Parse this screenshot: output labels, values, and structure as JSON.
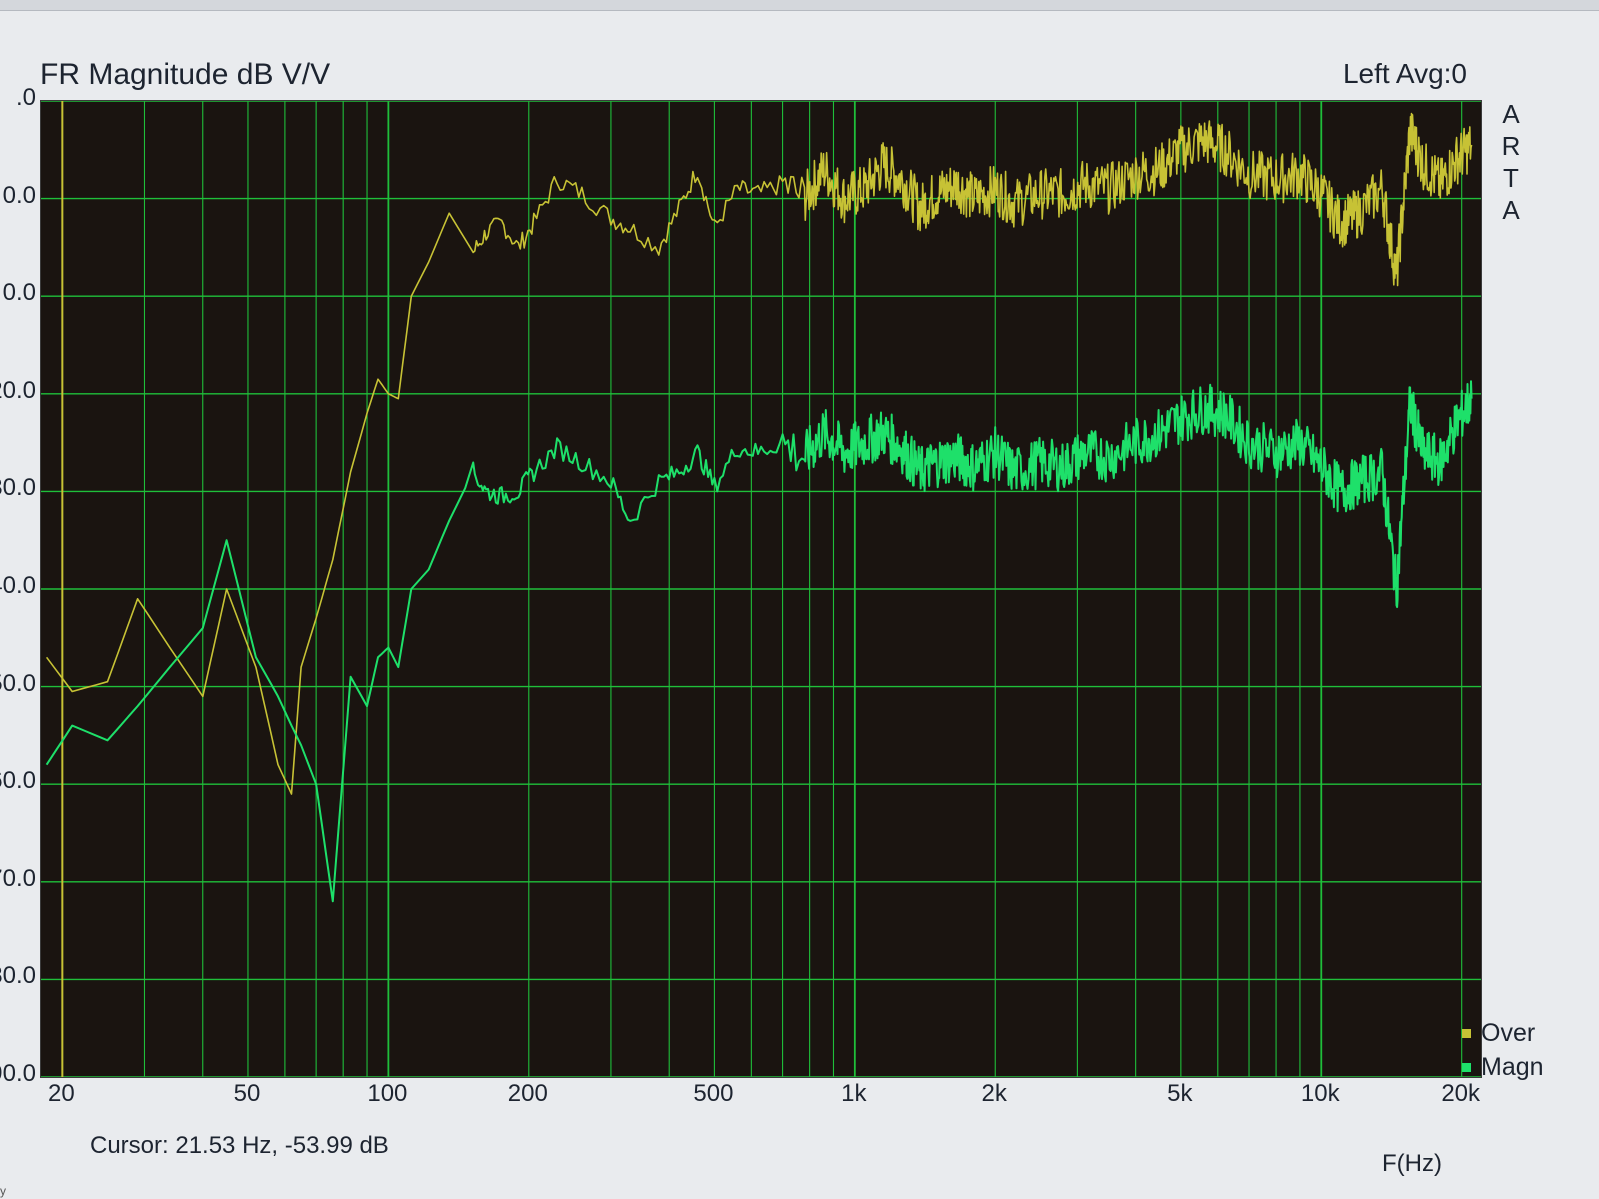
{
  "app": {
    "brand_letters": [
      "A",
      "R",
      "T",
      "A"
    ],
    "corner_mark": "y"
  },
  "header": {
    "title": "FR Magnitude dB V/V",
    "channel": "Left  Avg:0"
  },
  "cursor_readout": "Cursor: 21.53 Hz, -53.99 dB",
  "colors": {
    "plot_bg": "#1a1410",
    "grid": "#1fbf3a",
    "over": "#c7c235",
    "magn": "#1ee06a"
  },
  "chart_data": {
    "type": "line",
    "title": "FR Magnitude dB V/V",
    "xlabel": "F(Hz)",
    "ylabel": "",
    "x_scale": "log",
    "xlim": [
      18,
      22000
    ],
    "ylim": [
      -90,
      10
    ],
    "grid": true,
    "legend_position": "bottom-right",
    "x_ticks": [
      {
        "value": 20,
        "label": "20"
      },
      {
        "value": 50,
        "label": "50"
      },
      {
        "value": 100,
        "label": "100"
      },
      {
        "value": 200,
        "label": "200"
      },
      {
        "value": 500,
        "label": "500"
      },
      {
        "value": 1000,
        "label": "1k"
      },
      {
        "value": 2000,
        "label": "2k"
      },
      {
        "value": 5000,
        "label": "5k"
      },
      {
        "value": 10000,
        "label": "10k"
      },
      {
        "value": 20000,
        "label": "20k"
      }
    ],
    "y_ticks": [
      {
        "value": 10,
        "label": ".0"
      },
      {
        "value": 0,
        "label": "0.0"
      },
      {
        "value": -10,
        "label": "0.0"
      },
      {
        "value": -20,
        "label": "20.0"
      },
      {
        "value": -30,
        "label": "30.0"
      },
      {
        "value": -40,
        "label": "40.0"
      },
      {
        "value": -50,
        "label": "-50.0"
      },
      {
        "value": -60,
        "label": "-60.0"
      },
      {
        "value": -70,
        "label": "-70.0"
      },
      {
        "value": -80,
        "label": "-80.0"
      },
      {
        "value": -90,
        "label": "-90.0"
      }
    ],
    "series": [
      {
        "name": "Over",
        "color": "#c7c235",
        "x": [
          18.5,
          21,
          25,
          29,
          34,
          40,
          45,
          52,
          58,
          62,
          65,
          70,
          76,
          83,
          90,
          95,
          100,
          105,
          112,
          122,
          135,
          152,
          162,
          175,
          190,
          205,
          230,
          260,
          300,
          330,
          380,
          420,
          460,
          500,
          560,
          620,
          700,
          780,
          860,
          950,
          1050,
          1150,
          1260,
          1380,
          1500,
          1650,
          1800,
          2000,
          2200,
          2500,
          2800,
          3100,
          3500,
          4000,
          4500,
          5000,
          5600,
          6200,
          7000,
          8000,
          9000,
          10000,
          11000,
          12000,
          13500,
          14500,
          15500,
          16500,
          18000,
          19500,
          21000
        ],
        "y": [
          -47,
          -50.5,
          -49.5,
          -41,
          -46,
          -51,
          -40,
          -48,
          -58,
          -61,
          -48,
          -43,
          -37,
          -28,
          -22,
          -18.5,
          -20,
          -20.5,
          -10,
          -6.5,
          -1.5,
          -5.5,
          -3.5,
          -2.5,
          -5,
          -2.5,
          2,
          0.5,
          -2,
          -3,
          -5,
          -1,
          3,
          -3,
          1,
          0.5,
          1.5,
          0,
          3,
          0,
          1,
          3.5,
          2,
          -1,
          0.5,
          1.5,
          0,
          1,
          -0.5,
          0.5,
          0.5,
          1.5,
          1,
          2.5,
          3,
          5,
          6,
          5,
          2.5,
          2,
          2.5,
          0.5,
          -2.5,
          -1.5,
          1,
          -8,
          7,
          3.5,
          1.5,
          4,
          5.5
        ]
      },
      {
        "name": "Magn",
        "color": "#1ee06a",
        "x": [
          18.5,
          21,
          25,
          29,
          34,
          40,
          45,
          52,
          58,
          62,
          65,
          70,
          76,
          83,
          90,
          95,
          100,
          105,
          112,
          122,
          135,
          152,
          162,
          175,
          190,
          205,
          230,
          260,
          300,
          330,
          380,
          420,
          460,
          500,
          560,
          620,
          700,
          780,
          860,
          950,
          1050,
          1150,
          1260,
          1380,
          1500,
          1650,
          1800,
          2000,
          2200,
          2500,
          2800,
          3100,
          3500,
          4000,
          4500,
          5000,
          5600,
          6200,
          7000,
          8000,
          9000,
          10000,
          11000,
          12000,
          13500,
          14500,
          15500,
          16500,
          18000,
          19500,
          21000
        ],
        "y": [
          -58,
          -54,
          -55.5,
          -52,
          -48,
          -44,
          -35,
          -47,
          -51,
          -54,
          -56,
          -60,
          -72,
          -49,
          -52,
          -47,
          -46,
          -48,
          -40,
          -38,
          -33,
          -28,
          -30,
          -30.5,
          -30,
          -28,
          -25.5,
          -27,
          -29,
          -33,
          -29,
          -28,
          -26,
          -29.5,
          -25.5,
          -26,
          -25,
          -26.5,
          -24,
          -26,
          -25,
          -24,
          -25.5,
          -28,
          -27,
          -26.5,
          -27.5,
          -26,
          -28,
          -27,
          -27.5,
          -26,
          -26.5,
          -25,
          -24,
          -22.5,
          -21.5,
          -22,
          -25,
          -26,
          -25,
          -27.5,
          -30,
          -29,
          -28,
          -40,
          -21,
          -26,
          -27,
          -23,
          -20.5
        ]
      }
    ]
  }
}
